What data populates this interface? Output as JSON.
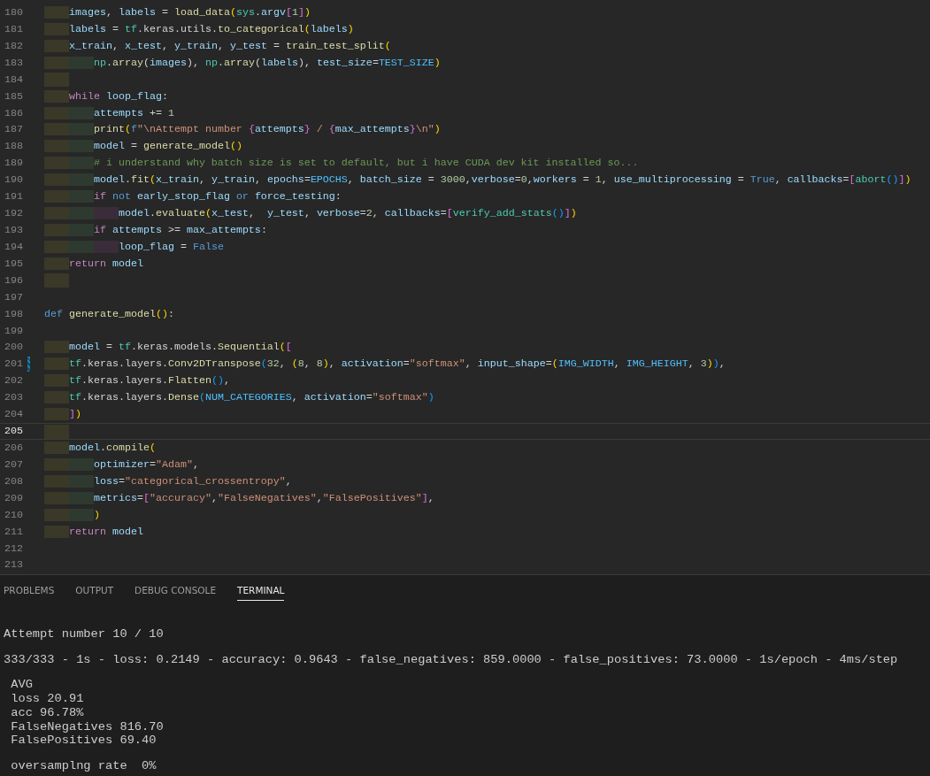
{
  "editor": {
    "lines": [
      {
        "number": "180",
        "current": false,
        "modified": false,
        "segments": [
          {
            "kind": "var",
            "text": "    images"
          },
          {
            "kind": "p",
            "text": ", "
          },
          {
            "kind": "var",
            "text": "labels"
          },
          {
            "kind": "p",
            "text": " = "
          },
          {
            "kind": "fn",
            "text": "load_data"
          },
          {
            "kind": "b1",
            "text": "("
          },
          {
            "kind": "mod",
            "text": "sys"
          },
          {
            "kind": "p",
            "text": "."
          },
          {
            "kind": "var",
            "text": "argv"
          },
          {
            "kind": "b2",
            "text": "["
          },
          {
            "kind": "num",
            "text": "1"
          },
          {
            "kind": "b2",
            "text": "]"
          },
          {
            "kind": "b1",
            "text": ")"
          }
        ]
      },
      {
        "number": "181",
        "current": false,
        "modified": false,
        "segments": [
          {
            "kind": "var",
            "text": "    labels"
          },
          {
            "kind": "p",
            "text": " = "
          },
          {
            "kind": "mod",
            "text": "tf"
          },
          {
            "kind": "p",
            "text": ".keras.utils."
          },
          {
            "kind": "fn",
            "text": "to_categorical"
          },
          {
            "kind": "b1",
            "text": "("
          },
          {
            "kind": "var",
            "text": "labels"
          },
          {
            "kind": "b1",
            "text": ")"
          }
        ]
      },
      {
        "number": "182",
        "current": false,
        "modified": false,
        "segments": [
          {
            "kind": "var",
            "text": "    x_train"
          },
          {
            "kind": "p",
            "text": ", "
          },
          {
            "kind": "var",
            "text": "x_test"
          },
          {
            "kind": "p",
            "text": ", "
          },
          {
            "kind": "var",
            "text": "y_train"
          },
          {
            "kind": "p",
            "text": ", "
          },
          {
            "kind": "var",
            "text": "y_test"
          },
          {
            "kind": "p",
            "text": " = "
          },
          {
            "kind": "fn",
            "text": "train_test_split"
          },
          {
            "kind": "b1",
            "text": "("
          }
        ]
      },
      {
        "number": "183",
        "current": false,
        "modified": false,
        "segments": [
          {
            "kind": "mod",
            "text": "        np"
          },
          {
            "kind": "p",
            "text": "."
          },
          {
            "kind": "fn",
            "text": "array"
          },
          {
            "kind": "p",
            "text": "("
          },
          {
            "kind": "var",
            "text": "images"
          },
          {
            "kind": "p",
            "text": "), "
          },
          {
            "kind": "mod",
            "text": "np"
          },
          {
            "kind": "p",
            "text": "."
          },
          {
            "kind": "fn",
            "text": "array"
          },
          {
            "kind": "p",
            "text": "("
          },
          {
            "kind": "var",
            "text": "labels"
          },
          {
            "kind": "p",
            "text": "), "
          },
          {
            "kind": "var",
            "text": "test_size"
          },
          {
            "kind": "p",
            "text": "="
          },
          {
            "kind": "const",
            "text": "TEST_SIZE"
          },
          {
            "kind": "b1",
            "text": ")"
          }
        ]
      },
      {
        "number": "184",
        "current": false,
        "modified": false,
        "indented": true
      },
      {
        "number": "185",
        "current": false,
        "modified": false,
        "segments": [
          {
            "kind": "ctl",
            "text": "    while "
          },
          {
            "kind": "var",
            "text": "loop_flag"
          },
          {
            "kind": "p",
            "text": ":"
          }
        ]
      },
      {
        "number": "186",
        "current": false,
        "modified": false,
        "segments": [
          {
            "kind": "var",
            "text": "        attempts"
          },
          {
            "kind": "p",
            "text": " += "
          },
          {
            "kind": "num",
            "text": "1"
          }
        ]
      },
      {
        "number": "187",
        "current": false,
        "modified": false,
        "segments": [
          {
            "kind": "fn",
            "text": "        print"
          },
          {
            "kind": "b1",
            "text": "("
          },
          {
            "kind": "kw",
            "text": "f"
          },
          {
            "kind": "str",
            "text": "\"\\nAttempt number "
          },
          {
            "kind": "b2",
            "text": "{"
          },
          {
            "kind": "var",
            "text": "attempts"
          },
          {
            "kind": "b2",
            "text": "}"
          },
          {
            "kind": "str",
            "text": " / "
          },
          {
            "kind": "b2",
            "text": "{"
          },
          {
            "kind": "var",
            "text": "max_attempts"
          },
          {
            "kind": "b2",
            "text": "}"
          },
          {
            "kind": "str",
            "text": "\\n\""
          },
          {
            "kind": "b1",
            "text": ")"
          }
        ]
      },
      {
        "number": "188",
        "current": false,
        "modified": false,
        "segments": [
          {
            "kind": "var",
            "text": "        model"
          },
          {
            "kind": "p",
            "text": " = "
          },
          {
            "kind": "fn",
            "text": "generate_model"
          },
          {
            "kind": "b1",
            "text": "()"
          }
        ]
      },
      {
        "number": "189",
        "current": false,
        "modified": false,
        "segments": [
          {
            "kind": "com",
            "text": "        # i understand why batch size is set to default, but i have CUDA dev kit installed so..."
          }
        ]
      },
      {
        "number": "190",
        "current": false,
        "modified": false,
        "segments": [
          {
            "kind": "var",
            "text": "        model"
          },
          {
            "kind": "p",
            "text": "."
          },
          {
            "kind": "fn",
            "text": "fit"
          },
          {
            "kind": "b1",
            "text": "("
          },
          {
            "kind": "var",
            "text": "x_train"
          },
          {
            "kind": "p",
            "text": ", "
          },
          {
            "kind": "var",
            "text": "y_train"
          },
          {
            "kind": "p",
            "text": ", "
          },
          {
            "kind": "var",
            "text": "epochs"
          },
          {
            "kind": "p",
            "text": "="
          },
          {
            "kind": "const",
            "text": "EPOCHS"
          },
          {
            "kind": "p",
            "text": ", "
          },
          {
            "kind": "var",
            "text": "batch_size"
          },
          {
            "kind": "p",
            "text": " = "
          },
          {
            "kind": "num",
            "text": "3000"
          },
          {
            "kind": "p",
            "text": ","
          },
          {
            "kind": "var",
            "text": "verbose"
          },
          {
            "kind": "p",
            "text": "="
          },
          {
            "kind": "num",
            "text": "0"
          },
          {
            "kind": "p",
            "text": ","
          },
          {
            "kind": "var",
            "text": "workers"
          },
          {
            "kind": "p",
            "text": " = "
          },
          {
            "kind": "num",
            "text": "1"
          },
          {
            "kind": "p",
            "text": ", "
          },
          {
            "kind": "var",
            "text": "use_multiprocessing"
          },
          {
            "kind": "p",
            "text": " = "
          },
          {
            "kind": "kw",
            "text": "True"
          },
          {
            "kind": "p",
            "text": ", "
          },
          {
            "kind": "var",
            "text": "callbacks"
          },
          {
            "kind": "p",
            "text": "="
          },
          {
            "kind": "b2",
            "text": "["
          },
          {
            "kind": "mod",
            "text": "abort"
          },
          {
            "kind": "b3",
            "text": "()"
          },
          {
            "kind": "b2",
            "text": "]"
          },
          {
            "kind": "b1",
            "text": ")"
          }
        ]
      },
      {
        "number": "191",
        "current": false,
        "modified": false,
        "segments": [
          {
            "kind": "ctl",
            "text": "        if "
          },
          {
            "kind": "kw",
            "text": "not "
          },
          {
            "kind": "var",
            "text": "early_stop_flag "
          },
          {
            "kind": "kw",
            "text": "or "
          },
          {
            "kind": "var",
            "text": "force_testing"
          },
          {
            "kind": "p",
            "text": ":"
          }
        ]
      },
      {
        "number": "192",
        "current": false,
        "modified": false,
        "segments": [
          {
            "kind": "var",
            "text": "            model"
          },
          {
            "kind": "p",
            "text": "."
          },
          {
            "kind": "fn",
            "text": "evaluate"
          },
          {
            "kind": "b1",
            "text": "("
          },
          {
            "kind": "var",
            "text": "x_test"
          },
          {
            "kind": "p",
            "text": ",  "
          },
          {
            "kind": "var",
            "text": "y_test"
          },
          {
            "kind": "p",
            "text": ", "
          },
          {
            "kind": "var",
            "text": "verbose"
          },
          {
            "kind": "p",
            "text": "="
          },
          {
            "kind": "num",
            "text": "2"
          },
          {
            "kind": "p",
            "text": ", "
          },
          {
            "kind": "var",
            "text": "callbacks"
          },
          {
            "kind": "p",
            "text": "="
          },
          {
            "kind": "b2",
            "text": "["
          },
          {
            "kind": "mod",
            "text": "verify_add_stats"
          },
          {
            "kind": "b3",
            "text": "()"
          },
          {
            "kind": "b2",
            "text": "]"
          },
          {
            "kind": "b1",
            "text": ")"
          }
        ]
      },
      {
        "number": "193",
        "current": false,
        "modified": false,
        "segments": [
          {
            "kind": "ctl",
            "text": "        if "
          },
          {
            "kind": "var",
            "text": "attempts"
          },
          {
            "kind": "p",
            "text": " >= "
          },
          {
            "kind": "var",
            "text": "max_attempts"
          },
          {
            "kind": "p",
            "text": ":"
          }
        ]
      },
      {
        "number": "194",
        "current": false,
        "modified": false,
        "segments": [
          {
            "kind": "var",
            "text": "            loop_flag"
          },
          {
            "kind": "p",
            "text": " = "
          },
          {
            "kind": "kw",
            "text": "False"
          }
        ]
      },
      {
        "number": "195",
        "current": false,
        "modified": false,
        "segments": [
          {
            "kind": "ctl",
            "text": "    return "
          },
          {
            "kind": "var",
            "text": "model"
          }
        ]
      },
      {
        "number": "196",
        "current": false,
        "modified": false,
        "indented": true
      },
      {
        "number": "197",
        "current": false,
        "modified": false,
        "indented": false
      },
      {
        "number": "198",
        "current": false,
        "modified": false,
        "segments": [
          {
            "kind": "kw",
            "text": "def "
          },
          {
            "kind": "fn",
            "text": "generate_model"
          },
          {
            "kind": "b1",
            "text": "()"
          },
          {
            "kind": "p",
            "text": ":"
          }
        ]
      },
      {
        "number": "199",
        "current": false,
        "modified": false,
        "indented": false
      },
      {
        "number": "200",
        "current": false,
        "modified": false,
        "segments": [
          {
            "kind": "var",
            "text": "    model"
          },
          {
            "kind": "p",
            "text": " = "
          },
          {
            "kind": "mod",
            "text": "tf"
          },
          {
            "kind": "p",
            "text": ".keras.models."
          },
          {
            "kind": "fn",
            "text": "Sequential"
          },
          {
            "kind": "b1",
            "text": "("
          },
          {
            "kind": "b2",
            "text": "["
          }
        ]
      },
      {
        "number": "201",
        "current": false,
        "modified": true,
        "segments": [
          {
            "kind": "mod",
            "text": "    tf"
          },
          {
            "kind": "p",
            "text": ".keras.layers."
          },
          {
            "kind": "fn",
            "text": "Conv2DTranspose"
          },
          {
            "kind": "b3",
            "text": "("
          },
          {
            "kind": "num",
            "text": "32"
          },
          {
            "kind": "p",
            "text": ", "
          },
          {
            "kind": "b1",
            "text": "("
          },
          {
            "kind": "num",
            "text": "8"
          },
          {
            "kind": "p",
            "text": ", "
          },
          {
            "kind": "num",
            "text": "8"
          },
          {
            "kind": "b1",
            "text": ")"
          },
          {
            "kind": "p",
            "text": ", "
          },
          {
            "kind": "var",
            "text": "activation"
          },
          {
            "kind": "p",
            "text": "="
          },
          {
            "kind": "str",
            "text": "\"softmax\""
          },
          {
            "kind": "p",
            "text": ", "
          },
          {
            "kind": "var",
            "text": "input_shape"
          },
          {
            "kind": "p",
            "text": "="
          },
          {
            "kind": "b1",
            "text": "("
          },
          {
            "kind": "const",
            "text": "IMG_WIDTH"
          },
          {
            "kind": "p",
            "text": ", "
          },
          {
            "kind": "const",
            "text": "IMG_HEIGHT"
          },
          {
            "kind": "p",
            "text": ", "
          },
          {
            "kind": "num",
            "text": "3"
          },
          {
            "kind": "b1",
            "text": ")"
          },
          {
            "kind": "b3",
            "text": ")"
          },
          {
            "kind": "p",
            "text": ","
          }
        ]
      },
      {
        "number": "202",
        "current": false,
        "modified": false,
        "segments": [
          {
            "kind": "mod",
            "text": "    tf"
          },
          {
            "kind": "p",
            "text": ".keras.layers."
          },
          {
            "kind": "fn",
            "text": "Flatten"
          },
          {
            "kind": "b3",
            "text": "()"
          },
          {
            "kind": "p",
            "text": ","
          }
        ]
      },
      {
        "number": "203",
        "current": false,
        "modified": false,
        "segments": [
          {
            "kind": "mod",
            "text": "    tf"
          },
          {
            "kind": "p",
            "text": ".keras.layers."
          },
          {
            "kind": "fn",
            "text": "Dense"
          },
          {
            "kind": "b3",
            "text": "("
          },
          {
            "kind": "const",
            "text": "NUM_CATEGORIES"
          },
          {
            "kind": "p",
            "text": ", "
          },
          {
            "kind": "var",
            "text": "activation"
          },
          {
            "kind": "p",
            "text": "="
          },
          {
            "kind": "str",
            "text": "\"softmax\""
          },
          {
            "kind": "b3",
            "text": ")"
          }
        ]
      },
      {
        "number": "204",
        "current": false,
        "modified": false,
        "segments": [
          {
            "kind": "b2",
            "text": "    ]"
          },
          {
            "kind": "b1",
            "text": ")"
          }
        ]
      },
      {
        "number": "205",
        "current": true,
        "modified": false,
        "indented": true
      },
      {
        "number": "206",
        "current": false,
        "modified": false,
        "segments": [
          {
            "kind": "var",
            "text": "    model"
          },
          {
            "kind": "p",
            "text": "."
          },
          {
            "kind": "fn",
            "text": "compile"
          },
          {
            "kind": "b1",
            "text": "("
          }
        ]
      },
      {
        "number": "207",
        "current": false,
        "modified": false,
        "segments": [
          {
            "kind": "var",
            "text": "        optimizer"
          },
          {
            "kind": "p",
            "text": "="
          },
          {
            "kind": "str",
            "text": "\"Adam\""
          },
          {
            "kind": "p",
            "text": ","
          }
        ]
      },
      {
        "number": "208",
        "current": false,
        "modified": false,
        "segments": [
          {
            "kind": "var",
            "text": "        loss"
          },
          {
            "kind": "p",
            "text": "="
          },
          {
            "kind": "str",
            "text": "\"categorical_crossentropy\""
          },
          {
            "kind": "p",
            "text": ","
          }
        ]
      },
      {
        "number": "209",
        "current": false,
        "modified": false,
        "segments": [
          {
            "kind": "var",
            "text": "        metrics"
          },
          {
            "kind": "p",
            "text": "="
          },
          {
            "kind": "b2",
            "text": "["
          },
          {
            "kind": "str",
            "text": "\"accuracy\""
          },
          {
            "kind": "p",
            "text": ","
          },
          {
            "kind": "str",
            "text": "\"FalseNegatives\""
          },
          {
            "kind": "p",
            "text": ","
          },
          {
            "kind": "str",
            "text": "\"FalsePositives\""
          },
          {
            "kind": "b2",
            "text": "]"
          },
          {
            "kind": "p",
            "text": ","
          }
        ]
      },
      {
        "number": "210",
        "current": false,
        "modified": false,
        "segments": [
          {
            "kind": "b1",
            "text": "        )"
          }
        ]
      },
      {
        "number": "211",
        "current": false,
        "modified": false,
        "segments": [
          {
            "kind": "ctl",
            "text": "    return "
          },
          {
            "kind": "var",
            "text": "model"
          }
        ]
      },
      {
        "number": "212",
        "current": false,
        "modified": false,
        "indented": false
      },
      {
        "number": "213",
        "current": false,
        "modified": false,
        "indented": false
      }
    ]
  },
  "panel": {
    "tabs": [
      {
        "label": "PROBLEMS",
        "selected": false
      },
      {
        "label": "OUTPUT",
        "selected": false
      },
      {
        "label": "DEBUG CONSOLE",
        "selected": false
      },
      {
        "label": "TERMINAL",
        "selected": true
      }
    ],
    "terminal": {
      "blocks": [
        {
          "lines": [
            "Attempt number 10 / 10"
          ]
        },
        {
          "lines": [
            "333/333 - 1s - loss: 0.2149 - accuracy: 0.9643 - false_negatives: 859.0000 - false_positives: 73.0000 - 1s/epoch - 4ms/step"
          ]
        },
        {
          "lines": [
            " AVG",
            " loss 20.91",
            " acc 96.78%",
            " FalseNegatives 816.70",
            " FalsePositives 69.40"
          ]
        },
        {
          "lines": [
            " oversamplng rate  0%"
          ]
        }
      ]
    }
  }
}
